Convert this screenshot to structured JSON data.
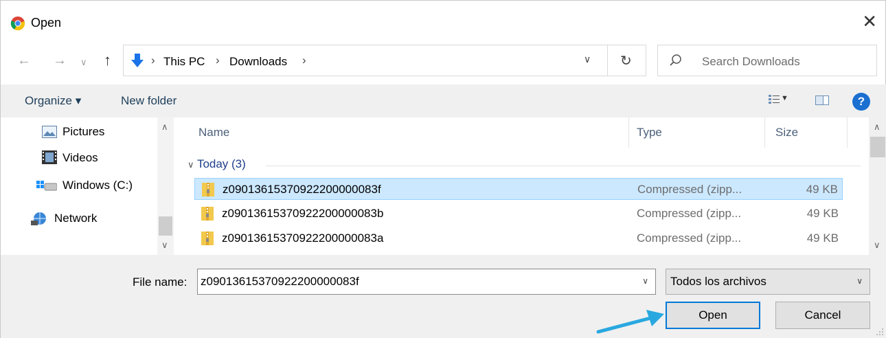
{
  "title": "Open",
  "address": {
    "crumbs": [
      "This PC",
      "Downloads"
    ]
  },
  "search": {
    "placeholder": "Search Downloads"
  },
  "toolbar": {
    "organize_label": "Organize ▾",
    "new_folder_label": "New folder",
    "help_label": "?"
  },
  "nav": {
    "items": [
      {
        "label": "Pictures",
        "icon": "pictures-icon"
      },
      {
        "label": "Videos",
        "icon": "videos-icon"
      },
      {
        "label": "Windows (C:)",
        "icon": "drive-icon"
      },
      {
        "label": "Network",
        "icon": "network-icon"
      }
    ]
  },
  "list": {
    "columns": {
      "name": "Name",
      "type": "Type",
      "size": "Size"
    },
    "group_label": "Today (3)",
    "rows": [
      {
        "name": "z09013615370922200000083f",
        "type": "Compressed (zipp...",
        "size": "49 KB",
        "selected": true
      },
      {
        "name": "z09013615370922200000083b",
        "type": "Compressed (zipp...",
        "size": "49 KB",
        "selected": false
      },
      {
        "name": "z09013615370922200000083a",
        "type": "Compressed (zipp...",
        "size": "49 KB",
        "selected": false
      }
    ]
  },
  "bottom": {
    "file_name_label": "File name:",
    "file_name_value": "z09013615370922200000083f",
    "file_type_value": "Todos los archivos",
    "open_label": "Open",
    "cancel_label": "Cancel"
  },
  "colors": {
    "selection": "#cce8ff",
    "accent": "#0078d7",
    "annotation_arrow": "#29a8e0"
  }
}
